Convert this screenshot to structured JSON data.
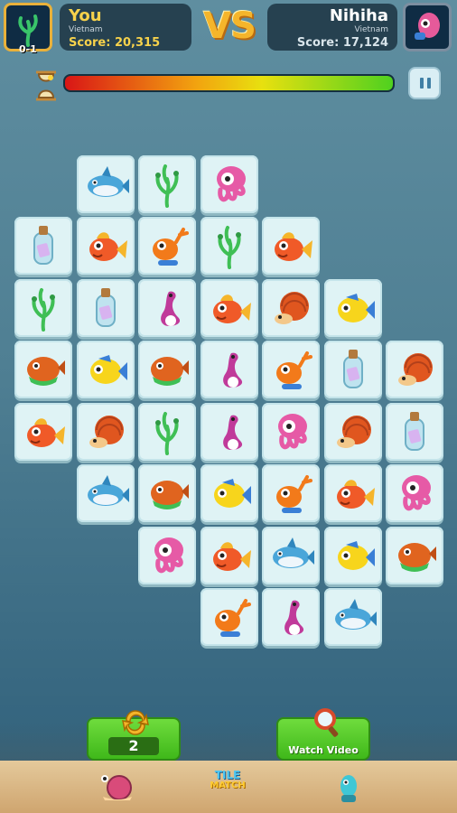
{
  "player": {
    "name": "You",
    "country": "Vietnam",
    "score_text": "Score: 20,315",
    "badge": "0-1"
  },
  "opponent": {
    "name": "Nihiha",
    "country": "Vietnam",
    "score_text": "Score: 17,124"
  },
  "vs_label": "VS",
  "time_remaining_fraction": 1.0,
  "colors": {
    "accent": "#f5b52b",
    "button_green": "#3fb81a",
    "tile_bg": "#dff3f5"
  },
  "board": {
    "rows": [
      [
        null,
        null,
        null,
        null,
        null,
        null,
        null
      ],
      [
        null,
        "shark",
        "seaweed",
        "squid",
        null,
        null,
        null
      ],
      [
        "bottle",
        "goldfish",
        "crab",
        "seaweed",
        "goldfish",
        null,
        null
      ],
      [
        "seaweed",
        "bottle",
        "dino",
        "goldfish",
        "hermit",
        "yellowfish",
        null
      ],
      [
        "piranha",
        "yellowfish",
        "piranha",
        "dino",
        "crab",
        "bottle",
        "hermit"
      ],
      [
        "goldfish",
        "hermit",
        "seaweed",
        "dino",
        "squid",
        "hermit",
        "bottle"
      ],
      [
        null,
        "shark",
        "piranha",
        "yellowfish",
        "crab",
        "goldfish",
        "squid"
      ],
      [
        null,
        null,
        "squid",
        "goldfish",
        "shark",
        "yellowfish",
        "piranha"
      ],
      [
        null,
        null,
        null,
        "crab",
        "dino",
        "shark",
        null
      ]
    ]
  },
  "controls": {
    "shuffle_count": "2",
    "watch_video_label": "Watch Video",
    "pause_icon": "pause-icon"
  },
  "bottom_nav": {
    "logo_line1": "TILE",
    "logo_line2": "MATCH"
  }
}
